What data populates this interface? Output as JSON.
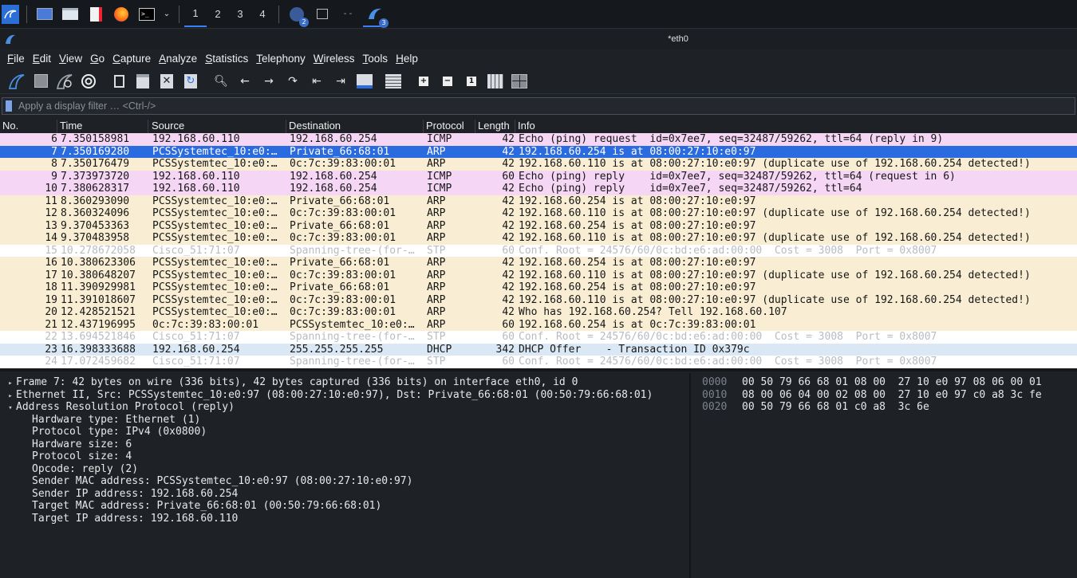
{
  "taskbar": {
    "workspaces": [
      "1",
      "2",
      "3",
      "4"
    ],
    "badge_a": "2",
    "badge_b": "3"
  },
  "window": {
    "title": "*eth0"
  },
  "menu": [
    "File",
    "Edit",
    "View",
    "Go",
    "Capture",
    "Analyze",
    "Statistics",
    "Telephony",
    "Wireless",
    "Tools",
    "Help"
  ],
  "filter": {
    "placeholder": "Apply a display filter … <Ctrl-/>"
  },
  "packet_list": {
    "headers": {
      "no": "No.",
      "time": "Time",
      "source": "Source",
      "destination": "Destination",
      "protocol": "Protocol",
      "length": "Length",
      "info": "Info"
    },
    "rows": [
      {
        "no": "6",
        "time": "7.350158981",
        "source": "192.168.60.110",
        "destination": "192.168.60.254",
        "protocol": "ICMP",
        "length": "42",
        "info": "Echo (ping) request  id=0x7ee7, seq=32487/59262, ttl=64 (reply in 9)",
        "color": "#f5d6f4"
      },
      {
        "no": "7",
        "time": "7.350169280",
        "source": "PCSSystemtec_10:e0:…",
        "destination": "Private_66:68:01",
        "protocol": "ARP",
        "length": "42",
        "info": "192.168.60.254 is at 08:00:27:10:e0:97",
        "color": "#2a6be0",
        "selected": true
      },
      {
        "no": "8",
        "time": "7.350176479",
        "source": "PCSSystemtec_10:e0:…",
        "destination": "0c:7c:39:83:00:01",
        "protocol": "ARP",
        "length": "42",
        "info": "192.168.60.110 is at 08:00:27:10:e0:97 (duplicate use of 192.168.60.254 detected!)",
        "color": "#f9eed3"
      },
      {
        "no": "9",
        "time": "7.373973720",
        "source": "192.168.60.110",
        "destination": "192.168.60.254",
        "protocol": "ICMP",
        "length": "60",
        "info": "Echo (ping) reply    id=0x7ee7, seq=32487/59262, ttl=64 (request in 6)",
        "color": "#f5d6f4"
      },
      {
        "no": "10",
        "time": "7.380628317",
        "source": "192.168.60.110",
        "destination": "192.168.60.254",
        "protocol": "ICMP",
        "length": "42",
        "info": "Echo (ping) reply    id=0x7ee7, seq=32487/59262, ttl=64",
        "color": "#f5d6f4"
      },
      {
        "no": "11",
        "time": "8.360293090",
        "source": "PCSSystemtec_10:e0:…",
        "destination": "Private_66:68:01",
        "protocol": "ARP",
        "length": "42",
        "info": "192.168.60.254 is at 08:00:27:10:e0:97",
        "color": "#f9eed3"
      },
      {
        "no": "12",
        "time": "8.360324096",
        "source": "PCSSystemtec_10:e0:…",
        "destination": "0c:7c:39:83:00:01",
        "protocol": "ARP",
        "length": "42",
        "info": "192.168.60.110 is at 08:00:27:10:e0:97 (duplicate use of 192.168.60.254 detected!)",
        "color": "#f9eed3"
      },
      {
        "no": "13",
        "time": "9.370453363",
        "source": "PCSSystemtec_10:e0:…",
        "destination": "Private_66:68:01",
        "protocol": "ARP",
        "length": "42",
        "info": "192.168.60.254 is at 08:00:27:10:e0:97",
        "color": "#f9eed3"
      },
      {
        "no": "14",
        "time": "9.370483958",
        "source": "PCSSystemtec_10:e0:…",
        "destination": "0c:7c:39:83:00:01",
        "protocol": "ARP",
        "length": "42",
        "info": "192.168.60.110 is at 08:00:27:10:e0:97 (duplicate use of 192.168.60.254 detected!)",
        "color": "#f9eed3"
      },
      {
        "no": "15",
        "time": "10.278672058",
        "source": "Cisco_51:71:07",
        "destination": "Spanning-tree-(for-…",
        "protocol": "STP",
        "length": "60",
        "info": "Conf. Root = 24576/60/0c:bd:e6:ad:00:00  Cost = 3008  Port = 0x8007",
        "color": "#ffffff",
        "muted": true
      },
      {
        "no": "16",
        "time": "10.380623306",
        "source": "PCSSystemtec_10:e0:…",
        "destination": "Private_66:68:01",
        "protocol": "ARP",
        "length": "42",
        "info": "192.168.60.254 is at 08:00:27:10:e0:97",
        "color": "#f9eed3"
      },
      {
        "no": "17",
        "time": "10.380648207",
        "source": "PCSSystemtec_10:e0:…",
        "destination": "0c:7c:39:83:00:01",
        "protocol": "ARP",
        "length": "42",
        "info": "192.168.60.110 is at 08:00:27:10:e0:97 (duplicate use of 192.168.60.254 detected!)",
        "color": "#f9eed3"
      },
      {
        "no": "18",
        "time": "11.390929981",
        "source": "PCSSystemtec_10:e0:…",
        "destination": "Private_66:68:01",
        "protocol": "ARP",
        "length": "42",
        "info": "192.168.60.254 is at 08:00:27:10:e0:97",
        "color": "#f9eed3"
      },
      {
        "no": "19",
        "time": "11.391018607",
        "source": "PCSSystemtec_10:e0:…",
        "destination": "0c:7c:39:83:00:01",
        "protocol": "ARP",
        "length": "42",
        "info": "192.168.60.110 is at 08:00:27:10:e0:97 (duplicate use of 192.168.60.254 detected!)",
        "color": "#f9eed3"
      },
      {
        "no": "20",
        "time": "12.428521521",
        "source": "PCSSystemtec_10:e0:…",
        "destination": "0c:7c:39:83:00:01",
        "protocol": "ARP",
        "length": "42",
        "info": "Who has 192.168.60.254? Tell 192.168.60.107",
        "color": "#f9eed3"
      },
      {
        "no": "21",
        "time": "12.437196995",
        "source": "0c:7c:39:83:00:01",
        "destination": "PCSSystemtec_10:e0:…",
        "protocol": "ARP",
        "length": "60",
        "info": "192.168.60.254 is at 0c:7c:39:83:00:01",
        "color": "#f9eed3"
      },
      {
        "no": "22",
        "time": "13.694521846",
        "source": "Cisco_51:71:07",
        "destination": "Spanning-tree-(for-…",
        "protocol": "STP",
        "length": "60",
        "info": "Conf. Root = 24576/60/0c:bd:e6:ad:00:00  Cost = 3008  Port = 0x8007",
        "color": "#ffffff",
        "muted": true
      },
      {
        "no": "23",
        "time": "16.398333688",
        "source": "192.168.60.254",
        "destination": "255.255.255.255",
        "protocol": "DHCP",
        "length": "342",
        "info": "DHCP Offer    - Transaction ID 0x379c",
        "color": "#dae8f5"
      },
      {
        "no": "24",
        "time": "17.072459682",
        "source": "Cisco_51:71:07",
        "destination": "Spanning-tree-(for-…",
        "protocol": "STP",
        "length": "60",
        "info": "Conf. Root = 24576/60/0c:bd:e6:ad:00:00  Cost = 3008  Port = 0x8007",
        "color": "#ffffff",
        "muted": true
      }
    ]
  },
  "details": [
    {
      "text": "Frame 7: 42 bytes on wire (336 bits), 42 bytes captured (336 bits) on interface eth0, id 0",
      "arrow": "▸",
      "indent": 0
    },
    {
      "text": "Ethernet II, Src: PCSSystemtec_10:e0:97 (08:00:27:10:e0:97), Dst: Private_66:68:01 (00:50:79:66:68:01)",
      "arrow": "▸",
      "indent": 0
    },
    {
      "text": "Address Resolution Protocol (reply)",
      "arrow": "▾",
      "indent": 0
    },
    {
      "text": "Hardware type: Ethernet (1)",
      "arrow": "",
      "indent": 1
    },
    {
      "text": "Protocol type: IPv4 (0x0800)",
      "arrow": "",
      "indent": 1
    },
    {
      "text": "Hardware size: 6",
      "arrow": "",
      "indent": 1
    },
    {
      "text": "Protocol size: 4",
      "arrow": "",
      "indent": 1
    },
    {
      "text": "Opcode: reply (2)",
      "arrow": "",
      "indent": 1
    },
    {
      "text": "Sender MAC address: PCSSystemtec_10:e0:97 (08:00:27:10:e0:97)",
      "arrow": "",
      "indent": 1
    },
    {
      "text": "Sender IP address: 192.168.60.254",
      "arrow": "",
      "indent": 1
    },
    {
      "text": "Target MAC address: Private_66:68:01 (00:50:79:66:68:01)",
      "arrow": "",
      "indent": 1
    },
    {
      "text": "Target IP address: 192.168.60.110",
      "arrow": "",
      "indent": 1
    }
  ],
  "bytes": [
    {
      "offset": "0000",
      "hex": "00 50 79 66 68 01 08 00  27 10 e0 97 08 06 00 01"
    },
    {
      "offset": "0010",
      "hex": "08 00 06 04 00 02 08 00  27 10 e0 97 c0 a8 3c fe"
    },
    {
      "offset": "0020",
      "hex": "00 50 79 66 68 01 c0 a8  3c 6e"
    }
  ],
  "colors": {
    "selected_row": "#2a6be0",
    "icmp_row": "#f5d6f4",
    "arp_row": "#f9eed3",
    "dhcp_row": "#dae8f5",
    "stp_row": "#ffffff",
    "accent": "#3b82f6"
  }
}
